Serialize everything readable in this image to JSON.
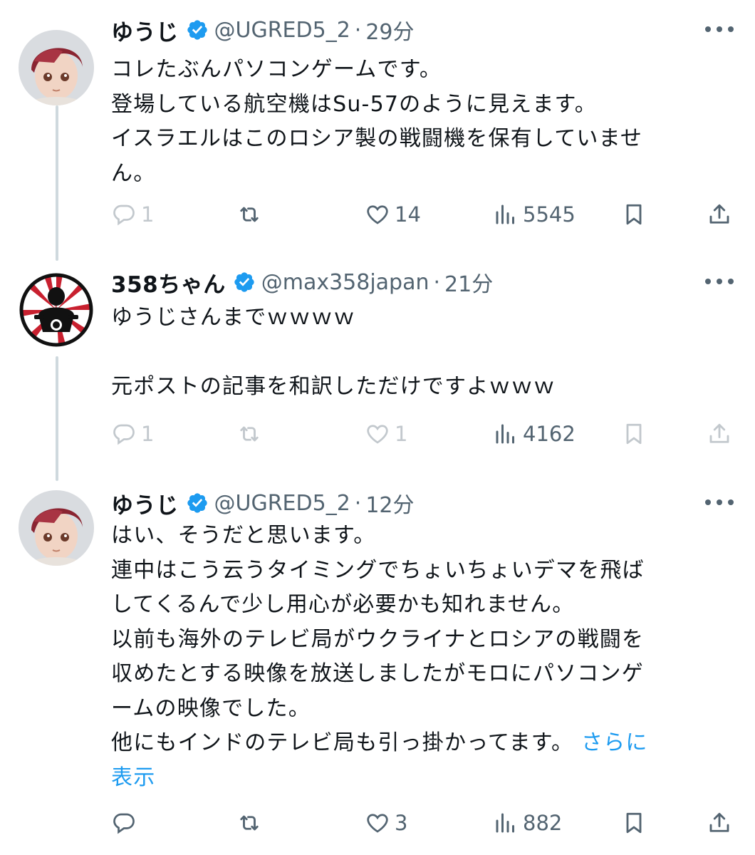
{
  "tweets": [
    {
      "name": "ゆうじ",
      "handle": "@UGRED5_2",
      "separator": "·",
      "time": "29分",
      "lines": [
        "コレたぶんパソコンゲームです。",
        "登場している航空機はSu-57のように見えます。",
        "イスラエルはこのロシア製の戦闘機を保有していませ",
        "ん。"
      ],
      "replies": "1",
      "retweets": "",
      "likes": "14",
      "views": "5545"
    },
    {
      "name": "358ちゃん",
      "handle": "@max358japan",
      "separator": "·",
      "time": "21分",
      "lines": [
        "ゆうじさんまでｗｗｗｗ",
        "",
        "元ポストの記事を和訳しただけですよｗｗｗ"
      ],
      "replies": "1",
      "retweets": "",
      "likes": "1",
      "views": "4162"
    },
    {
      "name": "ゆうじ",
      "handle": "@UGRED5_2",
      "separator": "·",
      "time": "12分",
      "lines": [
        "はい、そうだと思います。",
        "連中はこう云うタイミングでちょいちょいデマを飛ば",
        "してくるんで少し用心が必要かも知れません。",
        "以前も海外のテレビ局がウクライナとロシアの戦闘を",
        "収めたとする映像を放送しましたがモロにパソコンゲ",
        "ームの映像でした。",
        "他にもインドのテレビ局も引っ掛かってます。"
      ],
      "show_more": "さらに",
      "show_more_2": "表示",
      "replies": "",
      "retweets": "",
      "likes": "3",
      "views": "882"
    }
  ],
  "icons": {
    "verified": "verified-badge-icon",
    "reply": "reply-icon",
    "retweet": "retweet-icon",
    "like": "heart-icon",
    "views": "views-icon",
    "bookmark": "bookmark-icon",
    "share": "share-icon",
    "more": "more-icon"
  },
  "colors": {
    "accent": "#1d9bf0",
    "text": "#0f1419",
    "secondary": "#536471",
    "thread_line": "#cfd9de"
  }
}
